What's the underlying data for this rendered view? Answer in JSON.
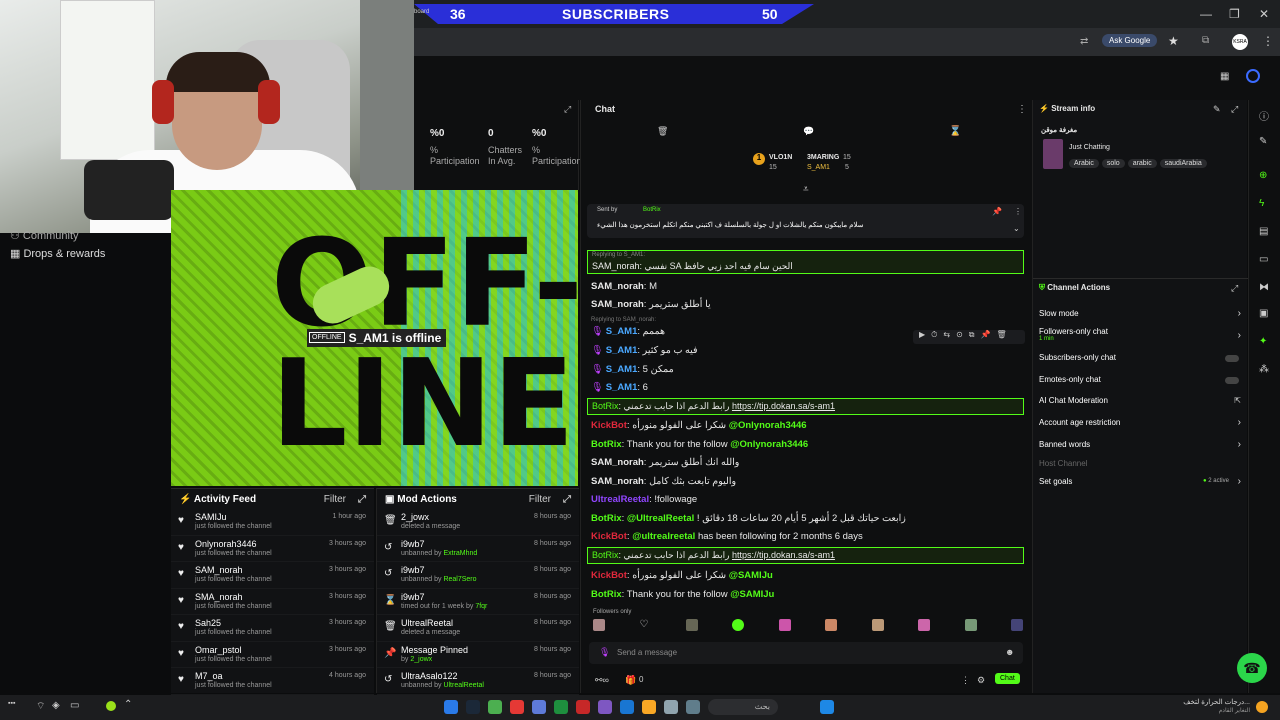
{
  "banner": {
    "left_count": "36",
    "label": "SUBSCRIBERS",
    "right_count": "50",
    "partial_text": "board"
  },
  "browser": {
    "ask_google": "Ask Google",
    "logo_text": "KSRA"
  },
  "stats": [
    {
      "value": "%0",
      "label": "%\nParticipation"
    },
    {
      "value": "0",
      "label": "Chatters\nIn Avg."
    },
    {
      "value": "%0",
      "label": "%\nParticipation"
    }
  ],
  "leftnav": {
    "community": "Community",
    "drops": "Drops & rewards"
  },
  "offline": {
    "badge": "OFFLINE",
    "message": "S_AM1 is offline",
    "art_line1": "OFF-",
    "art_line2": "LINE"
  },
  "activity": {
    "title": "Activity Feed",
    "filter": "Filter",
    "items": [
      {
        "name": "SAMIJu",
        "sub": "just followed the channel",
        "time": "1 hour ago"
      },
      {
        "name": "Onlynorah3446",
        "sub": "just followed the channel",
        "time": "3 hours ago"
      },
      {
        "name": "SAM_norah",
        "sub": "just followed the channel",
        "time": "3 hours ago"
      },
      {
        "name": "SMA_norah",
        "sub": "just followed the channel",
        "time": "3 hours ago"
      },
      {
        "name": "Sah25",
        "sub": "just followed the channel",
        "time": "3 hours ago"
      },
      {
        "name": "Omar_pstol",
        "sub": "just followed the channel",
        "time": "3 hours ago"
      },
      {
        "name": "M7_oa",
        "sub": "just followed the channel",
        "time": "4 hours ago"
      }
    ]
  },
  "mod": {
    "title": "Mod Actions",
    "filter": "Filter",
    "items": [
      {
        "name": "2_jowx",
        "sub": "deleted a message",
        "by": "",
        "time": "8 hours ago",
        "icon": "trash"
      },
      {
        "name": "i9wb7",
        "sub": "unbanned by",
        "by": "ExtraMhnd",
        "time": "8 hours ago",
        "icon": "undo"
      },
      {
        "name": "i9wb7",
        "sub": "unbanned by",
        "by": "Real7Sero",
        "time": "8 hours ago",
        "icon": "undo"
      },
      {
        "name": "i9wb7",
        "sub": "timed out for 1 week by",
        "by": "7fqr",
        "time": "8 hours ago",
        "icon": "hourglass"
      },
      {
        "name": "UltrealReetal",
        "sub": "deleted a message",
        "by": "",
        "time": "8 hours ago",
        "icon": "trash"
      },
      {
        "name": "Message Pinned",
        "sub": "by",
        "by": "2_jowx",
        "time": "8 hours ago",
        "icon": "pin"
      },
      {
        "name": "UltraAsalo122",
        "sub": "unbanned by",
        "by": "UltrealReetal",
        "time": "8 hours ago",
        "icon": "undo"
      }
    ]
  },
  "chat": {
    "title": "Chat",
    "leader1": {
      "name": "VLO1N",
      "count": "15"
    },
    "leader2": {
      "name": "3MARING",
      "count": "15"
    },
    "leader3": {
      "name": "S_AM1",
      "count": "5"
    },
    "pinned_label": "Sent by",
    "pinned_user": "BotRix",
    "pinned_text": "سلام مايبكون منكم يالشلات او ل جولة بالسلسلة ف اكتبني منكم اتكلم استخرمون هذا الشيء",
    "reply1_label": "Replying to S_AM1:",
    "msg_hl1_user": "SAM_norah",
    "msg_hl1_text": "نفسي SA الحين سام فيه احد زيي حافظ",
    "m1_user": "SAM_norah",
    "m1_text": "M",
    "m2_user": "SAM_norah",
    "m2_text": "يا أطلق ستريمر",
    "reply2_label": "Replying to SAM_norah:",
    "m3_user": "S_AM1",
    "m3_text": "هممم",
    "m4_user": "S_AM1",
    "m4_text": "فيه ب مو كثير",
    "m5_user": "S_AM1",
    "m5_text": "ممكن 5",
    "m6_user": "S_AM1",
    "m6_text": "6",
    "m7_user": "BotRix",
    "m7_text": "رابط الدعم اذا حابب تدعمني",
    "m7_link": "https://tip.dokan.sa/s-am1",
    "m8_user": "KickBot",
    "m8_text": "شكرا على الفولو منورأه",
    "m8_mention": "@Onlynorah3446",
    "m9_user": "BotRix",
    "m9_text": "Thank you for the follow",
    "m9_mention": "@Onlynorah3446",
    "m10_user": "SAM_norah",
    "m10_text": "والله انك أطلق ستريمر",
    "m11_user": "SAM_norah",
    "m11_text": "واليوم تابعت بثك كامل",
    "m12_user": "UltrealReetal",
    "m12_text": "!followage",
    "m13_user": "BotRix",
    "m13_mention": "@UltrealReetal",
    "m13_text": "! زابعت حياتك قبل 2 أشهر 5 أيام 20 ساعات 18 دقائق",
    "m14_user": "KickBot",
    "m14_mention": "@ultrealreetal",
    "m14_text": "has been following for 2 months 6 days",
    "m15_user": "BotRix",
    "m15_text": "رابط الدعم اذا حابب تدعمني",
    "m15_link": "https://tip.dokan.sa/s-am1",
    "m16_user": "KickBot",
    "m16_text": "شكرا على الفولو منورأه",
    "m16_mention": "@SAMIJu",
    "m17_user": "BotRix",
    "m17_text": "Thank you for the follow",
    "m17_mention": "@SAMIJu",
    "followers_only": "Followers only",
    "input_placeholder": "Send a message",
    "send_button": "Chat",
    "counter": "0"
  },
  "stream_info": {
    "title": "Stream info",
    "stream_title": "مغرفة موقن",
    "category": "Just Chatting",
    "tags": [
      "Arabic",
      "solo",
      "arabic",
      "saudiArabia"
    ]
  },
  "channel_actions": {
    "title": "Channel Actions",
    "slow": "Slow mode",
    "followers": "Followers-only chat",
    "followers_sub": "1 min",
    "subs": "Subscribers-only chat",
    "emotes": "Emotes-only chat",
    "ai": "AI Chat Moderation",
    "age": "Account age restriction",
    "banned": "Banned words",
    "host": "Host Channel",
    "goals": "Set goals",
    "goals_badge": "2 active"
  },
  "taskbar": {
    "search": "بحث",
    "news": "درجات الحرارة لتخف...",
    "news_sub": "التغاير القادم"
  },
  "colors": {
    "accent": "#53fc18",
    "banner": "#2a2fd8"
  }
}
